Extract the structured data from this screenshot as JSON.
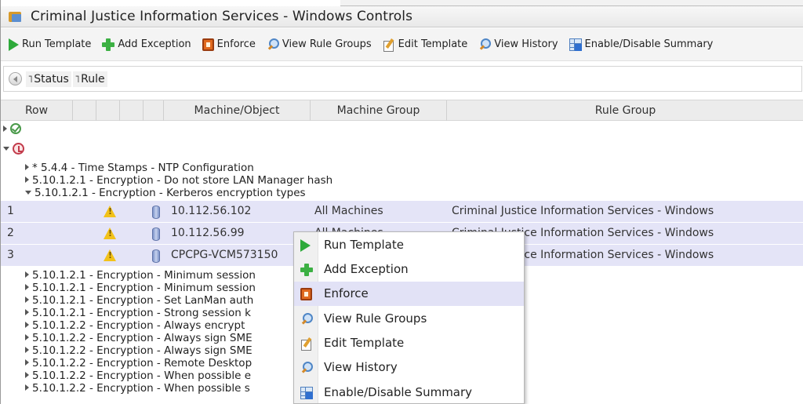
{
  "window": {
    "title": "Criminal Justice Information Services - Windows Controls"
  },
  "toolbar": {
    "items": [
      {
        "label": "Run Template",
        "icon": "play-icon"
      },
      {
        "label": "Add Exception",
        "icon": "plus-icon"
      },
      {
        "label": "Enforce",
        "icon": "enforce-icon"
      },
      {
        "label": "View Rule Groups",
        "icon": "magnifier-icon"
      },
      {
        "label": "Edit Template",
        "icon": "edit-icon"
      },
      {
        "label": "View History",
        "icon": "magnifier-icon"
      },
      {
        "label": "Enable/Disable Summary",
        "icon": "grid-icon"
      }
    ]
  },
  "groupby": {
    "chips": [
      "Status",
      "Rule"
    ]
  },
  "grid": {
    "columns": [
      "Row",
      "Machine/Object",
      "Machine Group",
      "Rule Group"
    ],
    "group_rules": [
      "* 5.4.4 - Time Stamps - NTP Configuration",
      "5.10.1.2.1 - Encryption - Do not store LAN Manager hash",
      "5.10.1.2.1 - Encryption - Kerberos encryption types"
    ],
    "rows": [
      {
        "row": "1",
        "machine": "10.112.56.102",
        "group": "All Machines",
        "rule_group": "Criminal Justice Information Services - Windows"
      },
      {
        "row": "2",
        "machine": "10.112.56.99",
        "group": "All Machines",
        "rule_group": "Criminal Justice Information Services - Windows"
      },
      {
        "row": "3",
        "machine": "CPCPG-VCM573150",
        "group": "",
        "rule_group": "Criminal Justice Information Services - Windows"
      }
    ],
    "more_rules": [
      "5.10.1.2.1 - Encryption - Minimum session",
      "5.10.1.2.1 - Encryption - Minimum session",
      "5.10.1.2.1 - Encryption - Set LanMan auth",
      "5.10.1.2.1 - Encryption - Strong session k",
      "5.10.1.2.2 - Encryption - Always encrypt",
      "5.10.1.2.2 - Encryption - Always sign SME",
      "5.10.1.2.2 - Encryption - Always sign SME",
      "5.10.1.2.2 - Encryption - Remote Desktop",
      "5.10.1.2.2 - Encryption - When possible e",
      "5.10.1.2.2 - Encryption - When possible s"
    ]
  },
  "context_menu": {
    "items": [
      {
        "label": "Run Template",
        "icon": "play-icon"
      },
      {
        "label": "Add Exception",
        "icon": "plus-icon"
      },
      {
        "label": "Enforce",
        "icon": "enforce-icon",
        "highlighted": true
      },
      {
        "label": "View Rule Groups",
        "icon": "magnifier-icon"
      },
      {
        "label": "Edit Template",
        "icon": "edit-icon"
      },
      {
        "label": "View History",
        "icon": "magnifier-icon"
      },
      {
        "label": "Enable/Disable Summary",
        "icon": "grid-icon"
      }
    ]
  },
  "colors": {
    "row_highlight": "#e4e4f7",
    "menu_highlight": "#e2e2f6",
    "run_green": "#2eaa3a",
    "warning_yellow": "#f2c21a"
  }
}
